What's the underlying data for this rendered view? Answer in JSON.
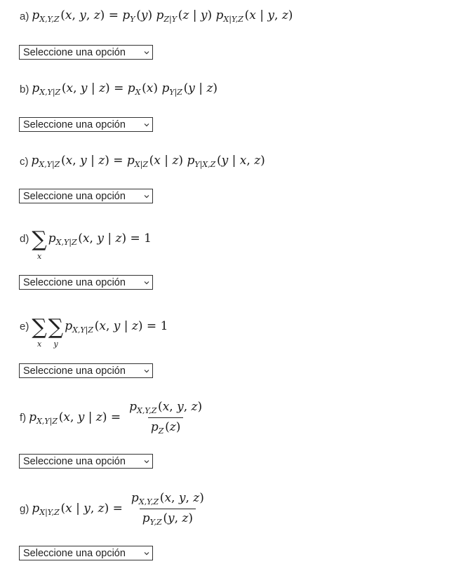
{
  "questions": [
    {
      "label": "a)",
      "formula": "p_{X,Y,Z}(x,y,z) = p_Y(y) p_{Z|Y}(z | y) p_{X|Y,Z}(x | y,z)"
    },
    {
      "label": "b)",
      "formula": "p_{X,Y|Z}(x,y | z) = p_X(x) p_{Y|Z}(y | z)"
    },
    {
      "label": "c)",
      "formula": "p_{X,Y|Z}(x,y | z) = p_{X|Z}(x | z) p_{Y|X,Z}(y | x,z)"
    },
    {
      "label": "d)",
      "formula": "sum_x p_{X,Y|Z}(x,y | z) = 1"
    },
    {
      "label": "e)",
      "formula": "sum_x sum_y p_{X,Y|Z}(x,y | z) = 1"
    },
    {
      "label": "f)",
      "formula": "p_{X,Y|Z}(x,y | z) = p_{X,Y,Z}(x,y,z) / p_Z(z)"
    },
    {
      "label": "g)",
      "formula": "p_{X|Y,Z}(x | y,z) = p_{X,Y,Z}(x,y,z) / p_{Y,Z}(y,z)"
    }
  ],
  "select_placeholder": "Seleccione una opción",
  "icons": {
    "dropdown": "chevron-down-icon"
  }
}
